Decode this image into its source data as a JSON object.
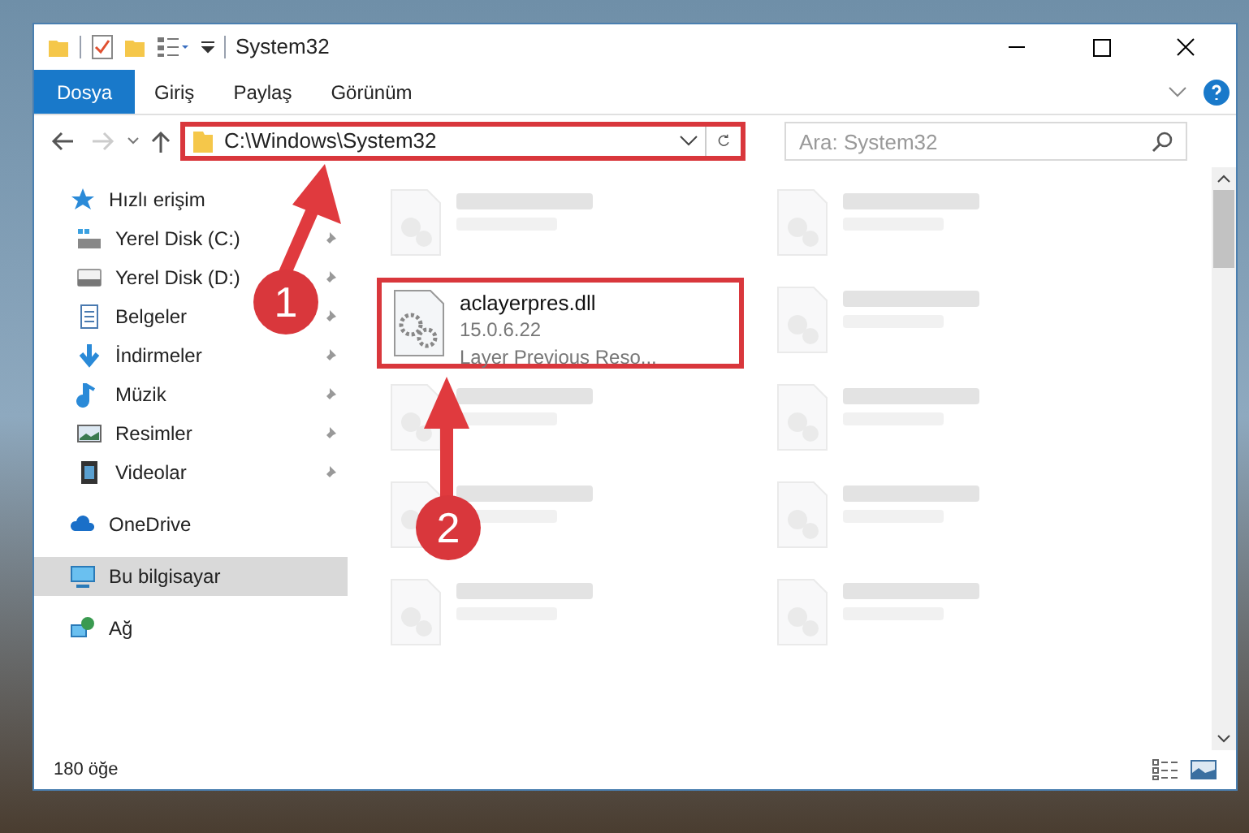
{
  "window": {
    "title": "System32"
  },
  "ribbon_tabs": [
    {
      "label": "Dosya",
      "selected": true
    },
    {
      "label": "Giriş",
      "selected": false
    },
    {
      "label": "Paylaş",
      "selected": false
    },
    {
      "label": "Görünüm",
      "selected": false
    }
  ],
  "address": {
    "path": "C:\\Windows\\System32"
  },
  "search": {
    "placeholder": "Ara: System32"
  },
  "nav": [
    {
      "label": "Hızlı erişim",
      "kind": "star",
      "selected": false,
      "children": [
        {
          "label": "Yerel Disk (C:)",
          "kind": "drive-c",
          "pinned": true
        },
        {
          "label": "Yerel Disk (D:)",
          "kind": "drive",
          "pinned": true
        },
        {
          "label": "Belgeler",
          "kind": "document",
          "pinned": true
        },
        {
          "label": "İndirmeler",
          "kind": "download",
          "pinned": true
        },
        {
          "label": "Müzik",
          "kind": "music",
          "pinned": true
        },
        {
          "label": "Resimler",
          "kind": "picture",
          "pinned": true
        },
        {
          "label": "Videolar",
          "kind": "video",
          "pinned": true
        }
      ]
    },
    {
      "label": "OneDrive",
      "kind": "cloud",
      "selected": false
    },
    {
      "label": "Bu bilgisayar",
      "kind": "computer",
      "selected": true
    },
    {
      "label": "Ağ",
      "kind": "network",
      "selected": false
    }
  ],
  "files": [
    {
      "kind": "blurred"
    },
    {
      "kind": "blurred"
    },
    {
      "kind": "file",
      "name": "aclayerpres.dll",
      "details": [
        "15.0.6.22",
        "Layer Previous Reso..."
      ]
    },
    {
      "kind": "blurred"
    },
    {
      "kind": "blurred"
    },
    {
      "kind": "blurred"
    },
    {
      "kind": "blurred"
    },
    {
      "kind": "blurred"
    },
    {
      "kind": "blurred"
    },
    {
      "kind": "blurred"
    }
  ],
  "status_bar": {
    "item_count": "180 öğe"
  },
  "annotations": [
    {
      "number": "1"
    },
    {
      "number": "2"
    }
  ]
}
